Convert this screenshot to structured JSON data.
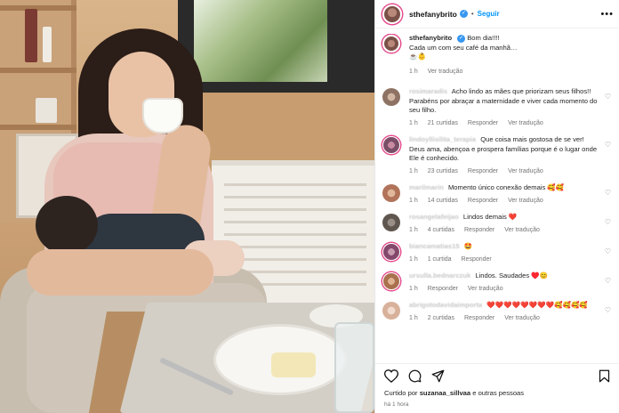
{
  "post": {
    "username": "sthefanybrito",
    "follow_label": "Seguir",
    "more_label": "•••",
    "separator": "•"
  },
  "comments": [
    {
      "username": "sthefanybrito",
      "verified": true,
      "text_line1": "Bom dia!!!!",
      "text_line2": "Cada um com seu café da manhã…",
      "text_line3": "☕👶",
      "time": "1 h",
      "likes": "",
      "action_reply": "",
      "action_translate": "Ver tradução"
    },
    {
      "username": "rosimaradis",
      "text": "Acho lindo as mães que priorizam seus filhos!! Parabéns por abraçar a maternidade e viver cada momento do seu filho.",
      "time": "1 h",
      "likes": "21 curtidas",
      "action_reply": "Responder",
      "action_translate": "Ver tradução"
    },
    {
      "username": "lindoyllisilita_terapia",
      "text": "Que coisa mais gostosa de se ver! Deus ama, abençoa e prospera famílias porque é o lugar onde Ele é conhecido.",
      "time": "1 h",
      "likes": "23 curtidas",
      "action_reply": "Responder",
      "action_translate": "Ver tradução"
    },
    {
      "username": "marilmarin",
      "text": "Momento único conexão demais 🥰🥰",
      "time": "1 h",
      "likes": "14 curtidas",
      "action_reply": "Responder",
      "action_translate": "Ver tradução"
    },
    {
      "username": "rosangelafeijao",
      "text": "Lindos demais ❤️",
      "time": "1 h",
      "likes": "4 curtidas",
      "action_reply": "Responder",
      "action_translate": "Ver tradução"
    },
    {
      "username": "biancamatias15",
      "text": "🤩",
      "time": "1 h",
      "likes": "1 curtida",
      "action_reply": "Responder",
      "action_translate": ""
    },
    {
      "username": "ursulla.bednarczuk",
      "text": "Lindos. Saudades ♥️😊",
      "time": "1 h",
      "likes": "",
      "action_reply": "Responder",
      "action_translate": "Ver tradução"
    },
    {
      "username": "abrigotodavidaimporta",
      "text": "❤️❤️❤️❤️❤️❤️❤️❤️🥰🥰🥰🥰",
      "time": "1 h",
      "likes": "2 curtidas",
      "action_reply": "Responder",
      "action_translate": "Ver tradução"
    }
  ],
  "actions": {
    "like_icon": "heart-icon",
    "comment_icon": "comment-icon",
    "share_icon": "send-icon",
    "save_icon": "bookmark-icon"
  },
  "liked_by": {
    "prefix": "Curtido por",
    "user": "suzanaa_sillvaa",
    "suffix": "e outras pessoas"
  },
  "post_time": "há 1 hora",
  "colors": {
    "accent": "#0095f6",
    "verified": "#3897f0",
    "story_ring": "#e44a8b"
  }
}
